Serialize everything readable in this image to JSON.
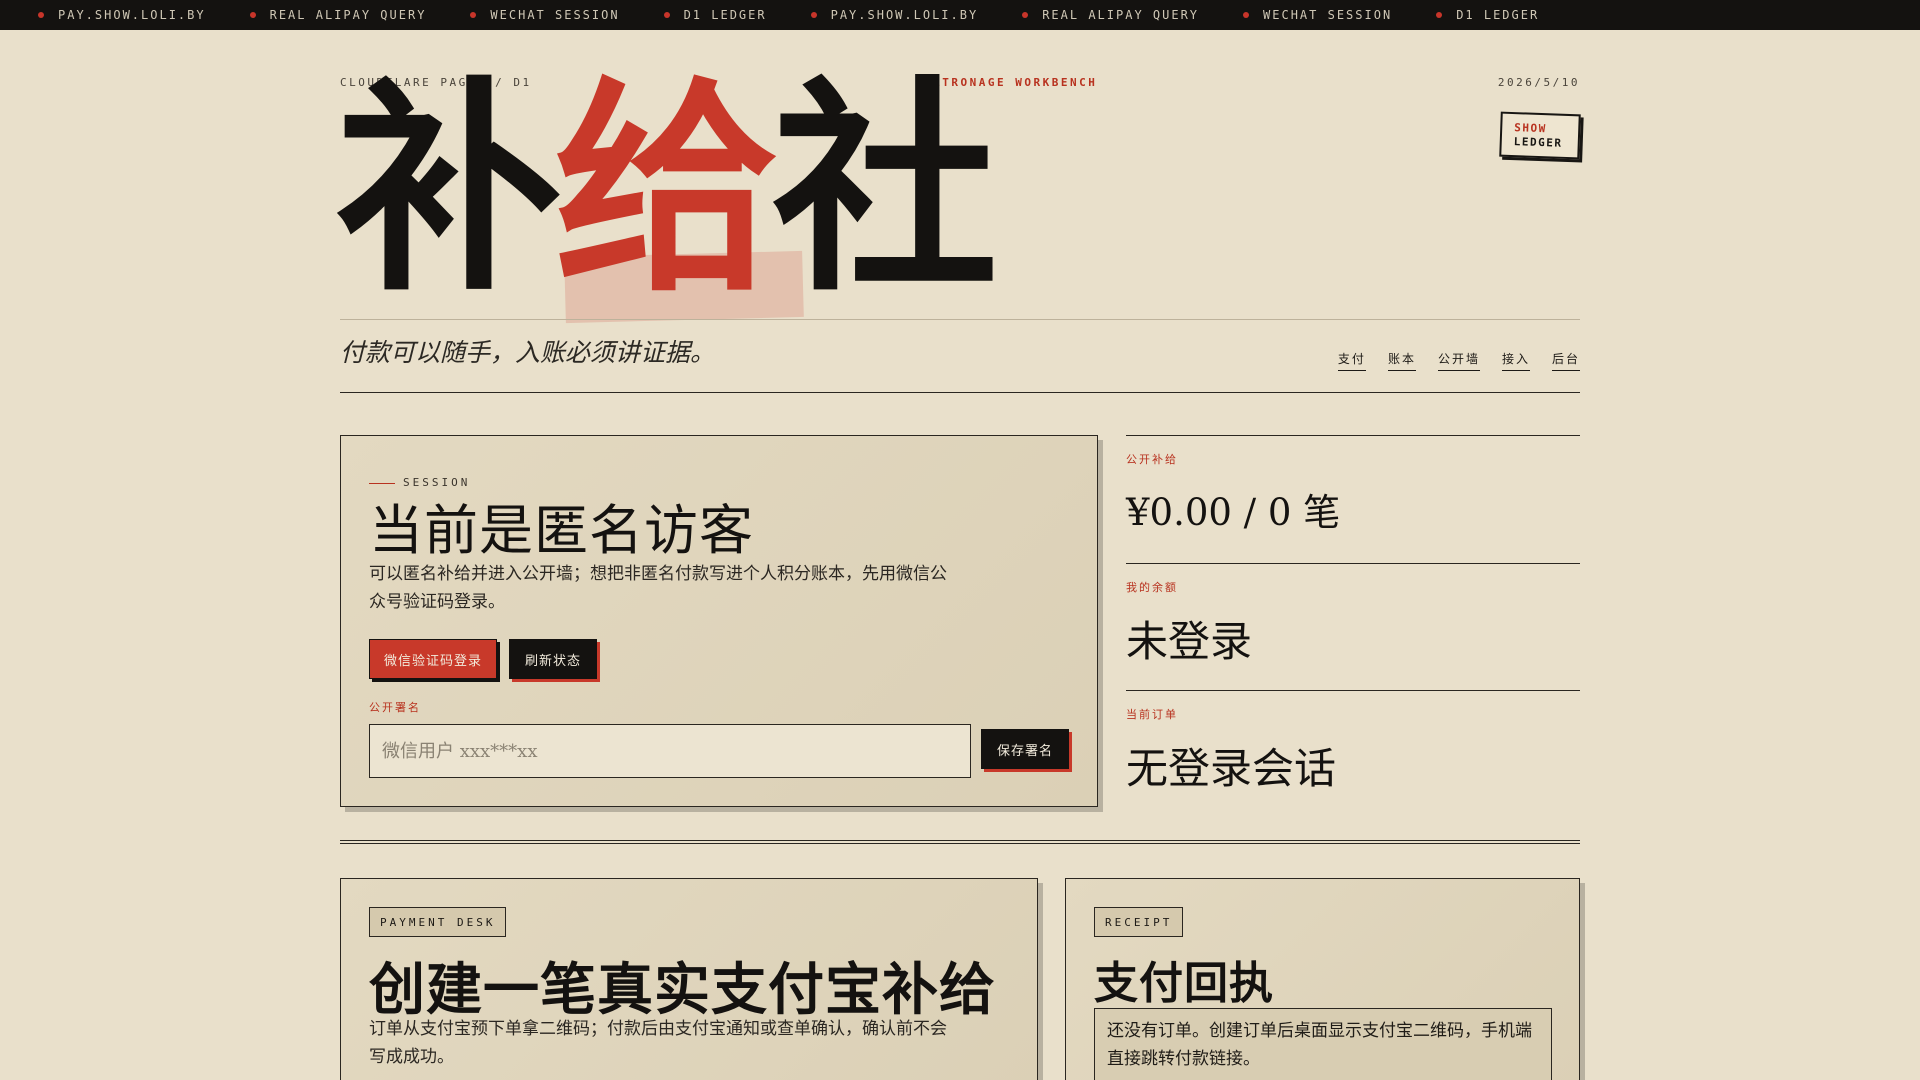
{
  "ticker": {
    "items": [
      "PAY.SHOW.LOLI.BY",
      "REAL ALIPAY QUERY",
      "WECHAT SESSION",
      "D1 LEDGER",
      "PAY.SHOW.LOLI.BY",
      "REAL ALIPAY QUERY",
      "WECHAT SESSION",
      "D1 LEDGER"
    ]
  },
  "masthead": {
    "platform": "CLOUDFLARE PAGES / D1",
    "section": "PATRONAGE WORKBENCH",
    "date": "2026/5/10",
    "logo_chars": [
      "补",
      "给",
      "社"
    ],
    "stamp_line1": "SHOW",
    "stamp_line2": "LEDGER",
    "tagline": "付款可以随手，入账必须讲证据。"
  },
  "nav": {
    "items": [
      "支付",
      "账本",
      "公开墙",
      "接入",
      "后台"
    ]
  },
  "session": {
    "eyebrow": "SESSION",
    "title": "当前是匿名访客",
    "description": "可以匿名补给并进入公开墙；想把非匿名付款写进个人积分账本，先用微信公众号验证码登录。",
    "login_button": "微信验证码登录",
    "refresh_button": "刷新状态",
    "signature_label": "公开署名",
    "signature_placeholder": "微信用户 xxx***xx",
    "save_button": "保存署名"
  },
  "stats": [
    {
      "label": "公开补给",
      "value": "¥0.00 / 0 笔"
    },
    {
      "label": "我的余额",
      "value": "未登录"
    },
    {
      "label": "当前订单",
      "value": "无登录会话"
    }
  ],
  "payment": {
    "chip": "PAYMENT DESK",
    "title": "创建一笔真实支付宝补给",
    "description": "订单从支付宝预下单拿二维码；付款后由支付宝通知或查单确认，确认前不会写成成功。"
  },
  "receipt": {
    "chip": "RECEIPT",
    "title": "支付回执",
    "message": "还没有订单。创建订单后桌面显示支付宝二维码，手机端直接跳转付款链接。"
  },
  "colors": {
    "background": "#e9e0cb",
    "ink": "#141210",
    "accent_red": "#c8392a"
  }
}
